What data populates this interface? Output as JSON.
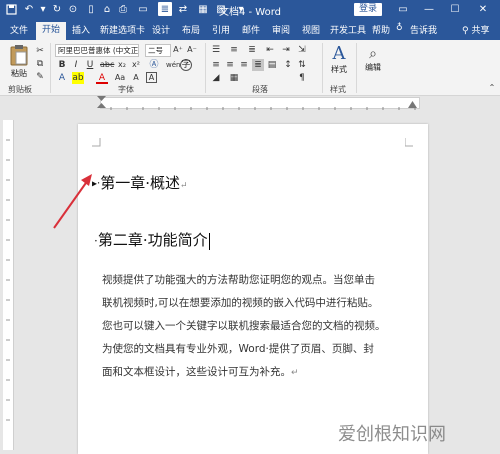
{
  "title": "文档4 - Word",
  "login_label": "登录",
  "tabs": [
    "文件",
    "开始",
    "插入",
    "新建选项卡",
    "设计",
    "布局",
    "引用",
    "邮件",
    "审阅",
    "视图",
    "开发工具",
    "帮助",
    "告诉我"
  ],
  "share_label": "共享",
  "ribbon": {
    "paste": "粘贴",
    "font_name": "阿里巴巴普惠体 (中文正",
    "font_size": "二号",
    "size_label": "wén",
    "style": "样式",
    "edit": "编辑",
    "groups": [
      "剪贴板",
      "字体",
      "段落",
      "样式"
    ]
  },
  "document": {
    "heading1": "第一章·概述",
    "heading2": "第二章·功能简介",
    "body_lines": [
      "视频提供了功能强大的方法帮助您证明您的观点。当您单击",
      "联机视频时,可以在想要添加的视频的嵌入代码中进行粘贴。",
      "您也可以键入一个关键字以联机搜索最适合您的文档的视频。",
      "为使您的文档具有专业外观，Word·提供了页眉、页脚、封",
      "面和文本框设计，这些设计可互为补充。"
    ]
  },
  "watermark": "爱创根知识网",
  "colors": {
    "title_bar": "#2b579a",
    "ribbon_bg": "#f3f3f3",
    "arrow": "#d9303a"
  }
}
